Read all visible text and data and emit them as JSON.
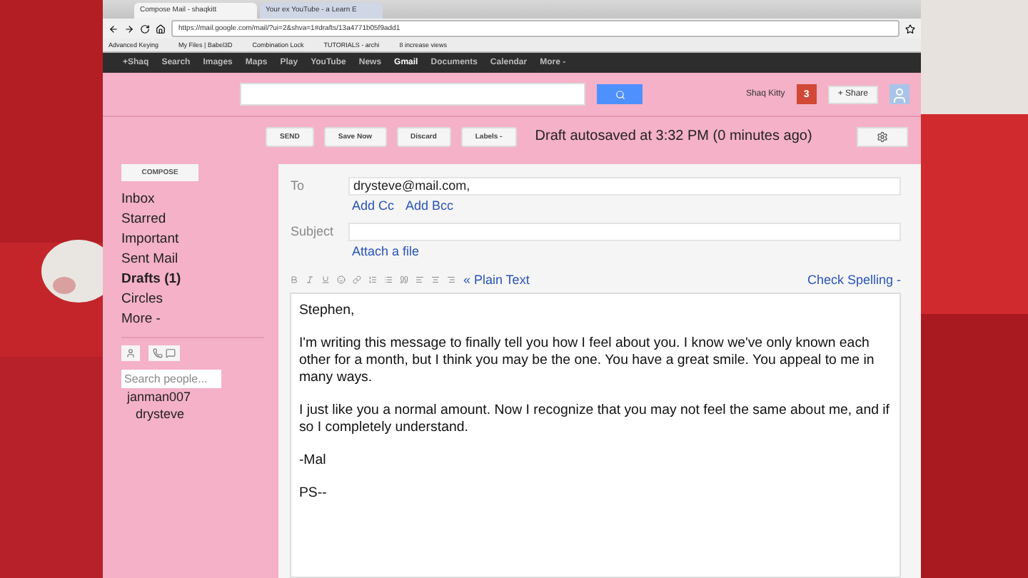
{
  "browser": {
    "tabs": [
      {
        "label": "Compose Mail - shaqkitt",
        "selected": true
      },
      {
        "label": "Your ex YouTube - a Learn E",
        "selected": false
      }
    ],
    "url": "https://mail.google.com/mail/?ui=2&shva=1#drafts/13a4771b05f9add1",
    "bookmarks": [
      "Advanced Keying",
      "My Files | Babel3D",
      "Combination Lock",
      "TUTORIALS - archi",
      "8 increase views"
    ]
  },
  "google_bar": [
    {
      "label": "+Shaq",
      "selected": false
    },
    {
      "label": "Search",
      "selected": false
    },
    {
      "label": "Images",
      "selected": false
    },
    {
      "label": "Maps",
      "selected": false
    },
    {
      "label": "Play",
      "selected": false
    },
    {
      "label": "YouTube",
      "selected": false
    },
    {
      "label": "News",
      "selected": false
    },
    {
      "label": "Gmail",
      "selected": true
    },
    {
      "label": "Documents",
      "selected": false
    },
    {
      "label": "Calendar",
      "selected": false
    },
    {
      "label": "More -",
      "selected": false
    }
  ],
  "account": {
    "name": "Shaq Kitty",
    "notifications": "3",
    "share": "+ Share"
  },
  "actions": [
    "SEND",
    "Save Now",
    "Discard",
    "Labels -"
  ],
  "status": "Draft autosaved at 3:32 PM (0 minutes ago)",
  "sidebar": {
    "compose": "COMPOSE",
    "items": [
      {
        "label": "Inbox",
        "selected": false
      },
      {
        "label": "Starred",
        "selected": false
      },
      {
        "label": "Important",
        "selected": false
      },
      {
        "label": "Sent Mail",
        "selected": false
      },
      {
        "label": "Drafts (1)",
        "selected": true
      },
      {
        "label": "Circles",
        "selected": false
      },
      {
        "label": "More -",
        "selected": false
      }
    ],
    "search_placeholder": "Search people...",
    "contacts": [
      "janman007",
      "drysteve"
    ]
  },
  "compose": {
    "to_label": "To",
    "to": "drysteve@mail.com,",
    "add_cc": "Add Cc",
    "add_bcc": "Add Bcc",
    "subject_label": "Subject",
    "attach": "Attach a file",
    "plain_text": "« Plain Text",
    "check_spelling": "Check Spelling -",
    "body": [
      "Stephen,",
      "I'm writing this message to finally tell you how I feel about you. I know we've only known each other for a month, but I think you may be the one. You have a great smile. You appeal to me in many ways.",
      "I just like you a normal amount. Now I recognize that you may not feel the same about me, and if so I completely understand.",
      "-Mal",
      "PS--"
    ]
  }
}
